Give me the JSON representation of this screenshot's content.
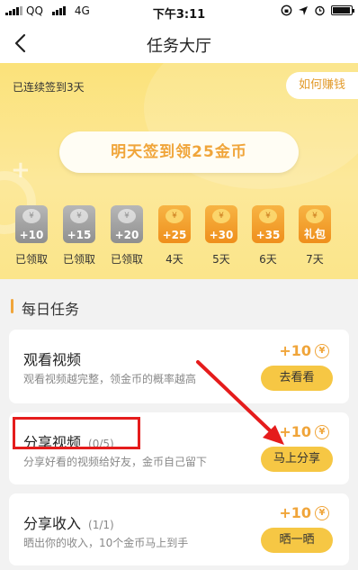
{
  "status_bar": {
    "carrier": "QQ",
    "network": "4G",
    "time": "下午3:11"
  },
  "nav": {
    "title": "任务大厅"
  },
  "banner": {
    "streak_text": "已连续签到3天",
    "earn_button": "如何赚钱",
    "signin_button": "明天签到领25金币",
    "days": [
      {
        "amount": "+10",
        "label": "已领取",
        "state": "claimed"
      },
      {
        "amount": "+15",
        "label": "已领取",
        "state": "claimed"
      },
      {
        "amount": "+20",
        "label": "已领取",
        "state": "claimed"
      },
      {
        "amount": "+25",
        "label": "4天",
        "state": "pending"
      },
      {
        "amount": "+30",
        "label": "5天",
        "state": "pending"
      },
      {
        "amount": "+35",
        "label": "6天",
        "state": "pending"
      },
      {
        "amount": "礼包",
        "label": "7天",
        "state": "pending"
      }
    ],
    "coin_symbol": "¥"
  },
  "daily": {
    "title": "每日任务",
    "tasks": [
      {
        "name": "观看视频",
        "progress": "",
        "desc": "观看视频越完整，领金币的概率越高",
        "reward": "+10",
        "action": "去看看"
      },
      {
        "name": "分享视频",
        "progress": "(0/5)",
        "desc": "分享好看的视频给好友，金币自己留下",
        "reward": "+10",
        "action": "马上分享"
      },
      {
        "name": "分享收入",
        "progress": "(1/1)",
        "desc": "晒出你的收入，10个金币马上到手",
        "reward": "+10",
        "action": "晒一晒"
      }
    ],
    "reward_symbol": "¥"
  },
  "colors": {
    "accent": "#f0a53a",
    "button": "#f6c744",
    "highlight": "#e51c1c"
  }
}
